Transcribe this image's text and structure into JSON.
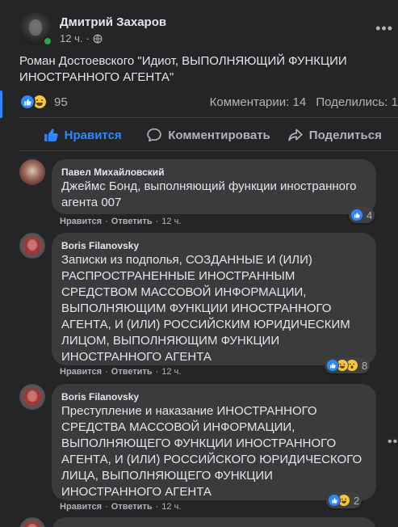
{
  "post": {
    "author": "Дмитрий Захаров",
    "time": "12 ч.",
    "text": "Роман Достоевского \"Идиот, ВЫПОЛНЯЮЩИЙ ФУНКЦИИ ИНОСТРАННОГО АГЕНТА\"",
    "reactions_count": "95",
    "comments_label": "Комментарии: 14",
    "shares_label": "Поделились: 1"
  },
  "actions": {
    "like": "Нравится",
    "comment": "Комментировать",
    "share": "Поделиться"
  },
  "comments": [
    {
      "author": "Павел Михайловский",
      "text": "Джеймс Бонд, выполняющий функции иностранного агента 007",
      "like_label": "Нравится",
      "reply_label": "Ответить",
      "time": "12 ч.",
      "reactions": "4"
    },
    {
      "author": "Boris Filanovsky",
      "text": "Записки из подполья, СОЗДАННЫЕ И (ИЛИ) РАСПРОСТРАНЕННЫЕ ИНОСТРАННЫМ СРЕДСТВОМ МАССОВОЙ ИНФОРМАЦИИ, ВЫПОЛНЯЮЩИМ ФУНКЦИИ ИНОСТРАННОГО АГЕНТА, И (ИЛИ) РОССИЙСКИМ ЮРИДИЧЕСКИМ ЛИЦОМ, ВЫПОЛНЯЮЩИМ ФУНКЦИИ ИНОСТРАННОГО АГЕНТА",
      "like_label": "Нравится",
      "reply_label": "Ответить",
      "time": "12 ч.",
      "reactions": "8"
    },
    {
      "author": "Boris Filanovsky",
      "text": "Преступление и наказание ИНОСТРАННОГО СРЕДСТВА МАССОВОЙ ИНФОРМАЦИИ, ВЫПОЛНЯЮЩЕГО ФУНКЦИИ ИНОСТРАННОГО АГЕНТА, И (ИЛИ) РОССИЙСКОГО ЮРИДИЧЕСКОГО ЛИЦА, ВЫПОЛНЯЮЩЕГО ФУНКЦИИ ИНОСТРАННОГО АГЕНТА",
      "like_label": "Нравится",
      "reply_label": "Ответить",
      "time": "12 ч.",
      "reactions": "2"
    }
  ],
  "colors": {
    "background": "#242526",
    "bubble": "#3a3b3c",
    "accent": "#2d88ff",
    "text": "#e4e6eb",
    "muted": "#b0b3b8"
  },
  "icons": [
    "globe-icon",
    "more-options-icon",
    "like-reaction-icon",
    "haha-reaction-icon",
    "wow-reaction-icon",
    "thumbs-up-icon",
    "comment-icon",
    "share-icon"
  ]
}
